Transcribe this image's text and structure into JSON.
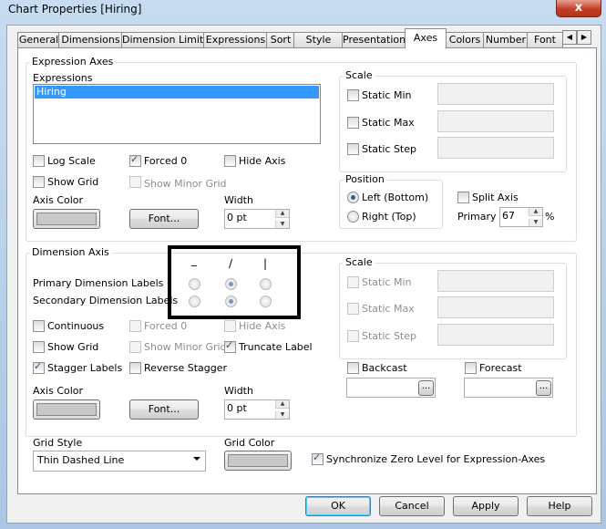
{
  "window": {
    "title": "Chart Properties [Hiring]",
    "close_glyph": "x"
  },
  "tabs": [
    {
      "label": "General"
    },
    {
      "label": "Dimensions"
    },
    {
      "label": "Dimension Limits"
    },
    {
      "label": "Expressions"
    },
    {
      "label": "Sort"
    },
    {
      "label": "Style"
    },
    {
      "label": "Presentation"
    },
    {
      "label": "Axes",
      "active": true
    },
    {
      "label": "Colors"
    },
    {
      "label": "Number"
    },
    {
      "label": "Font"
    }
  ],
  "tab_scroll": {
    "left": "◀",
    "right": "▶"
  },
  "expression_axes": {
    "group_label": "Expression Axes",
    "expressions_label": "Expressions",
    "expressions": [
      "Hiring"
    ],
    "log_scale": {
      "label": "Log Scale",
      "checked": false
    },
    "forced_0": {
      "label": "Forced 0",
      "checked": true
    },
    "hide_axis": {
      "label": "Hide Axis",
      "checked": false
    },
    "show_grid": {
      "label": "Show Grid",
      "checked": false
    },
    "show_minor_grid": {
      "label": "Show Minor Grid",
      "checked": false,
      "disabled": true
    },
    "axis_color_label": "Axis Color",
    "font_button": "Font...",
    "width_label": "Width",
    "width_value": "0 pt",
    "scale": {
      "group_label": "Scale",
      "static_min": {
        "label": "Static Min",
        "checked": false,
        "value": ""
      },
      "static_max": {
        "label": "Static Max",
        "checked": false,
        "value": ""
      },
      "static_step": {
        "label": "Static Step",
        "checked": false,
        "value": ""
      }
    },
    "position": {
      "group_label": "Position",
      "left_bottom": {
        "label": "Left (Bottom)",
        "selected": true
      },
      "right_top": {
        "label": "Right (Top)",
        "selected": false
      }
    },
    "split_axis": {
      "label": "Split Axis",
      "checked": false
    },
    "primary_label": "Primary",
    "primary_value": "67",
    "primary_unit": "%"
  },
  "dimension_axis": {
    "group_label": "Dimension Axis",
    "orientation_symbols": [
      "_",
      "/",
      "|"
    ],
    "primary_labels": {
      "label": "Primary Dimension Labels",
      "selected_index": 1
    },
    "secondary_labels": {
      "label": "Secondary Dimension Labels",
      "selected_index": 1
    },
    "continuous": {
      "label": "Continuous",
      "checked": false
    },
    "forced_0": {
      "label": "Forced 0",
      "checked": false,
      "disabled": true
    },
    "hide_axis": {
      "label": "Hide Axis",
      "checked": false,
      "disabled": true
    },
    "show_grid": {
      "label": "Show Grid",
      "checked": false
    },
    "show_minor_grid": {
      "label": "Show Minor Grid",
      "checked": false,
      "disabled": true
    },
    "truncate_label": {
      "label": "Truncate Label",
      "checked": true
    },
    "stagger_labels": {
      "label": "Stagger Labels",
      "checked": true
    },
    "reverse_stagger": {
      "label": "Reverse Stagger",
      "checked": false
    },
    "axis_color_label": "Axis Color",
    "font_button": "Font...",
    "width_label": "Width",
    "width_value": "0 pt",
    "scale": {
      "group_label": "Scale",
      "static_min": {
        "label": "Static Min",
        "disabled": true
      },
      "static_max": {
        "label": "Static Max",
        "disabled": true
      },
      "static_step": {
        "label": "Static Step",
        "disabled": true
      }
    },
    "backcast": {
      "label": "Backcast",
      "checked": false,
      "button": "..."
    },
    "forecast": {
      "label": "Forecast",
      "checked": false,
      "button": "..."
    }
  },
  "grid_style": {
    "label": "Grid Style",
    "value": "Thin Dashed Line"
  },
  "grid_color": {
    "label": "Grid Color"
  },
  "sync_zero": {
    "label": "Synchronize Zero Level for Expression-Axes",
    "checked": true
  },
  "buttons": {
    "ok": "OK",
    "cancel": "Cancel",
    "apply": "Apply",
    "help": "Help"
  },
  "colors": {
    "selection": "#3399ff",
    "swatch": "#c8c8c8",
    "highlight_border": "#000000"
  }
}
